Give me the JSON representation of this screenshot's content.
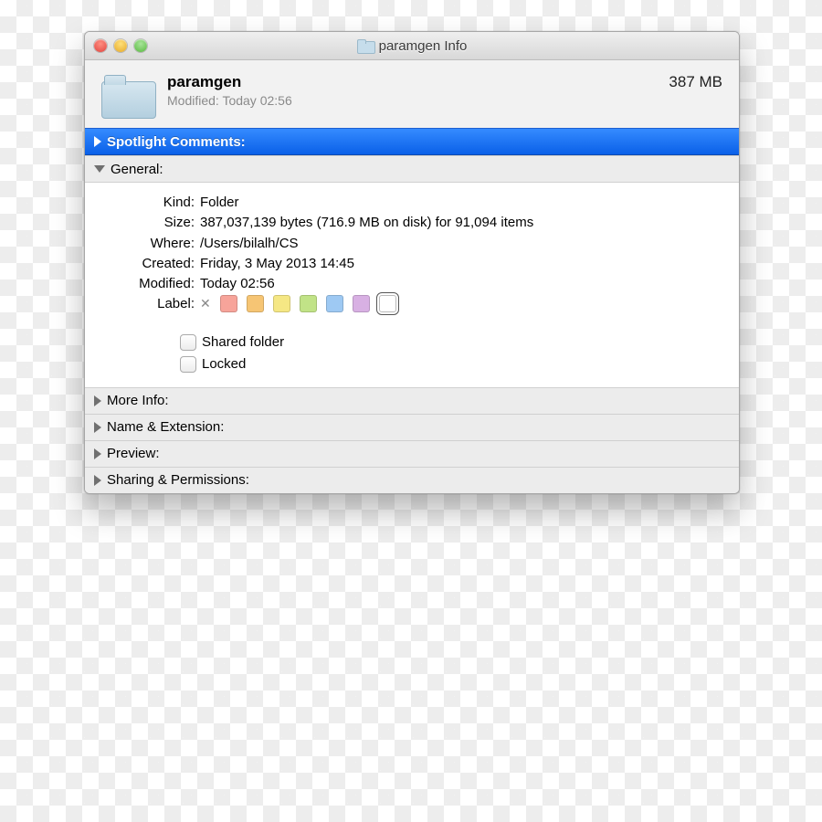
{
  "window": {
    "title": "paramgen Info"
  },
  "header": {
    "name": "paramgen",
    "modified_line": "Modified: Today 02:56",
    "size": "387 MB"
  },
  "sections": {
    "spotlight": "Spotlight Comments:",
    "general": "General:",
    "more_info": "More Info:",
    "name_ext": "Name & Extension:",
    "preview": "Preview:",
    "sharing": "Sharing & Permissions:"
  },
  "general": {
    "kind_label": "Kind:",
    "kind_value": "Folder",
    "size_label": "Size:",
    "size_value": "387,037,139 bytes (716.9 MB on disk) for 91,094 items",
    "where_label": "Where:",
    "where_value": "/Users/bilalh/CS",
    "created_label": "Created:",
    "created_value": "Friday, 3 May 2013 14:45",
    "modified_label": "Modified:",
    "modified_value": "Today 02:56",
    "label_label": "Label:",
    "shared_label": "Shared folder",
    "locked_label": "Locked",
    "label_colors": [
      "#f7a49a",
      "#f6c574",
      "#f5e784",
      "#c1e387",
      "#9ec9f3",
      "#d8b0e3"
    ]
  }
}
